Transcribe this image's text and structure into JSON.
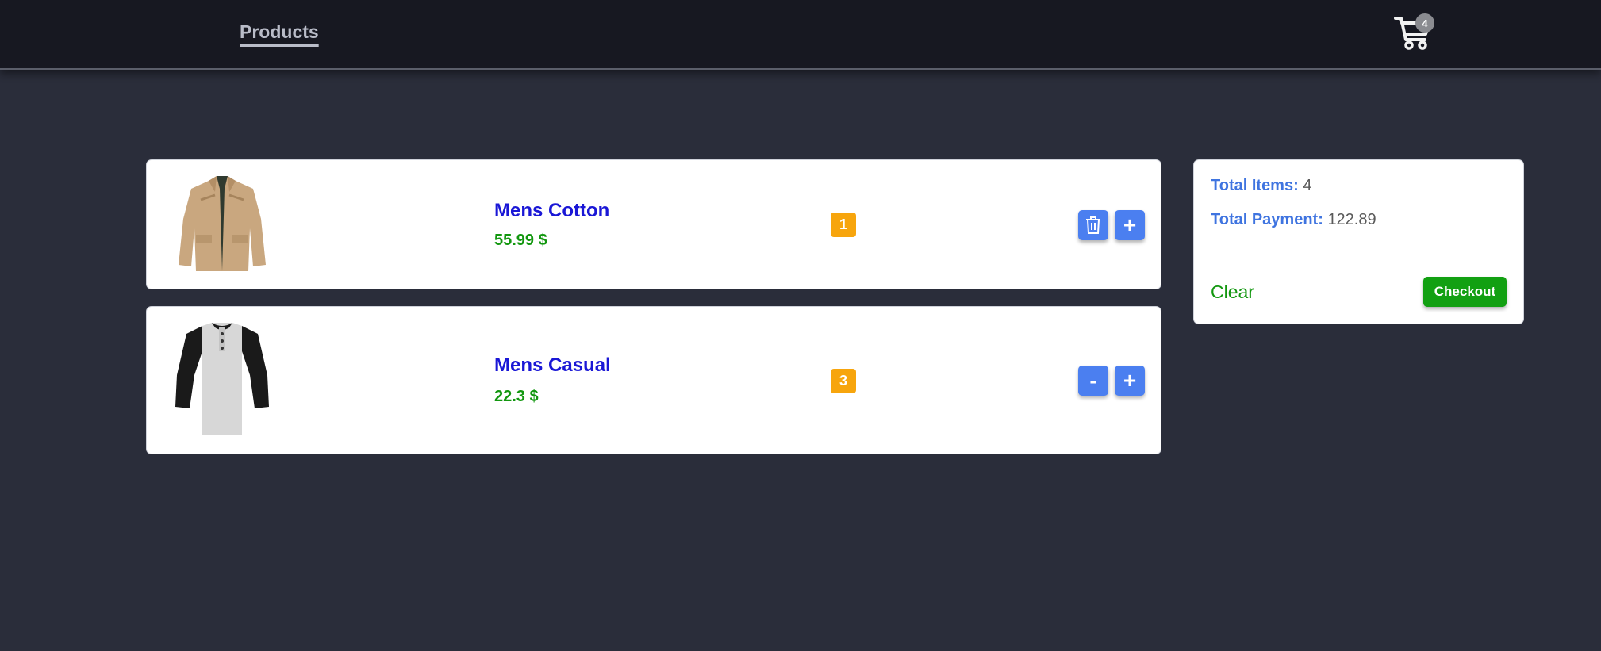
{
  "nav": {
    "products_label": "Products",
    "cart_count": "4",
    "cart_icon": "cart-icon"
  },
  "cart": {
    "items": [
      {
        "title": "Mens Cotton",
        "price": "55.99 $",
        "quantity": "1",
        "image": "jacket-image",
        "left_action": "delete-icon",
        "right_action": "+"
      },
      {
        "title": "Mens Casual",
        "price": "22.3 $",
        "quantity": "3",
        "image": "tshirt-image",
        "left_action": "-",
        "right_action": "+"
      }
    ]
  },
  "summary": {
    "total_items_label": "Total Items:",
    "total_items": "4",
    "total_payment_label": "Total Payment:",
    "total_payment": "122.89",
    "clear_label": "Clear",
    "checkout_label": "Checkout"
  },
  "colors": {
    "page_bg": "#2a2d3a",
    "nav_bg": "#171821",
    "title": "#1a17d6",
    "price": "#12970f",
    "badge": "#f7a50d",
    "button": "#4b7ff0",
    "checkout": "#12a012"
  }
}
